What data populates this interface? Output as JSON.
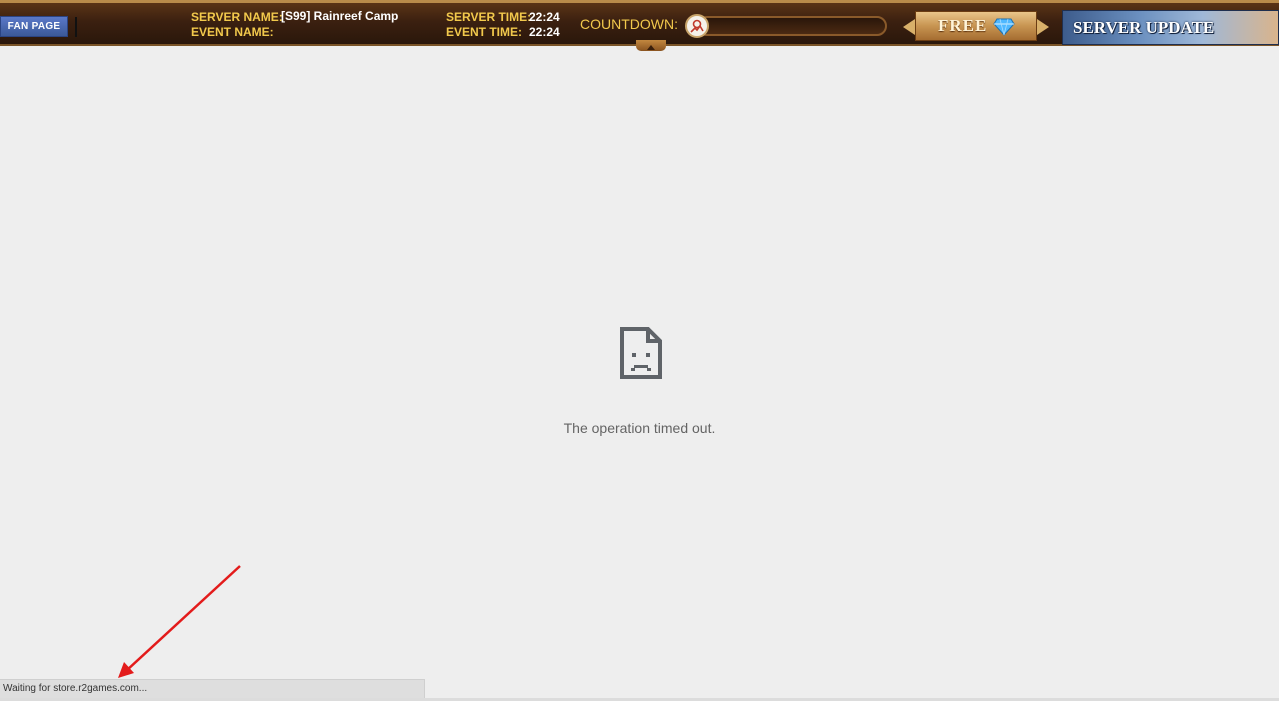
{
  "topbar": {
    "fan_page_label": "FAN PAGE",
    "server_name_label": "SERVER NAME:",
    "server_name_value": "[S99] Rainreef Camp",
    "event_name_label": "EVENT NAME:",
    "event_name_value": "",
    "server_time_label": "SERVER TIME:",
    "server_time_value": "22:24",
    "event_time_label": "EVENT TIME:",
    "event_time_value": "22:24",
    "countdown_label": "COUNTDOWN:",
    "free_label": "FREE",
    "server_update_label": "SERVER UPDATE"
  },
  "content": {
    "error_message": "The operation timed out."
  },
  "status_bar": {
    "text": "Waiting for store.r2games.com..."
  },
  "colors": {
    "accent_gold": "#f2c94c",
    "annotation_red": "#e31b1b",
    "fan_page_blue": "#3b5998"
  },
  "icons": {
    "error": "sad-page-icon",
    "diamond": "diamond-icon",
    "countdown": "countdown-avatar-icon"
  }
}
